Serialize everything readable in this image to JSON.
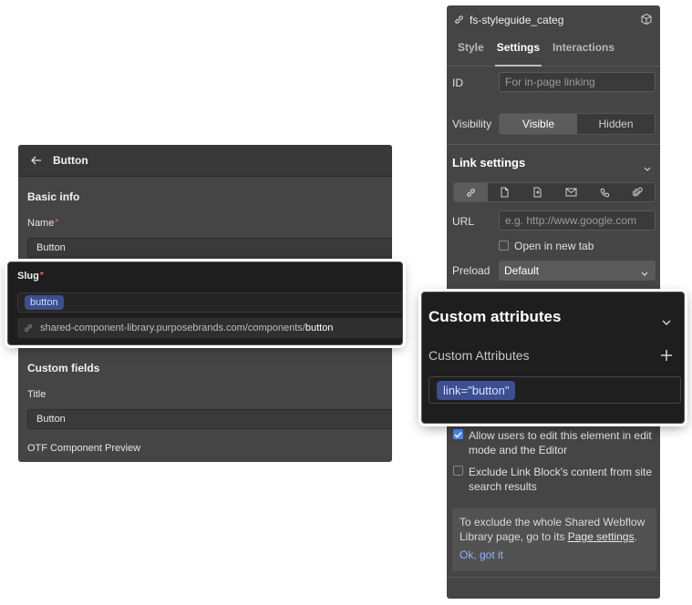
{
  "cms": {
    "header_title": "Button",
    "basic_info": "Basic info",
    "name_label": "Name",
    "required_mark": "*",
    "name_value": "Button",
    "custom_fields": "Custom fields",
    "title_label": "Title",
    "title_value": "Button",
    "otf_label": "OTF Component Preview"
  },
  "slug": {
    "label": "Slug",
    "required_mark": "*",
    "value": "button",
    "url_prefix": "shared-component-library.purposebrands.com/components/",
    "url_slug": "button"
  },
  "settings": {
    "element_name": "fs-styleguide_categ",
    "tabs": [
      {
        "label": "Style"
      },
      {
        "label": "Settings"
      },
      {
        "label": "Interactions"
      }
    ],
    "active_tab": "Settings",
    "id_label": "ID",
    "id_placeholder": "For in-page linking",
    "visibility_label": "Visibility",
    "visibility_options": [
      "Visible",
      "Hidden"
    ],
    "visibility_selected": "Visible",
    "link_settings": "Link settings",
    "link_types": [
      "url-icon",
      "page-icon",
      "section-icon",
      "email-icon",
      "phone-icon",
      "file-icon"
    ],
    "url_label": "URL",
    "url_placeholder": "e.g. http://www.google.com",
    "new_tab_label": "Open in new tab",
    "preload_label": "Preload",
    "preload_value": "Default",
    "allow_edit_label": "Allow users to edit this element in edit mode and the Editor",
    "exclude_label": "Exclude Link Block's content from site search results",
    "note_text": "To exclude the whole Shared Webflow Library page, go to its ",
    "note_link": "Page settings",
    "note_end": ".",
    "note_ok": "Ok, got it"
  },
  "custom_attributes": {
    "title": "Custom attributes",
    "subtitle": "Custom Attributes",
    "attribute": "link=\"button\""
  },
  "colors": {
    "panel_bg": "#454545",
    "popout_bg": "#1e1e1e",
    "chip_bg": "#3d4f8f",
    "checkbox_blue": "#4a8cf7"
  }
}
